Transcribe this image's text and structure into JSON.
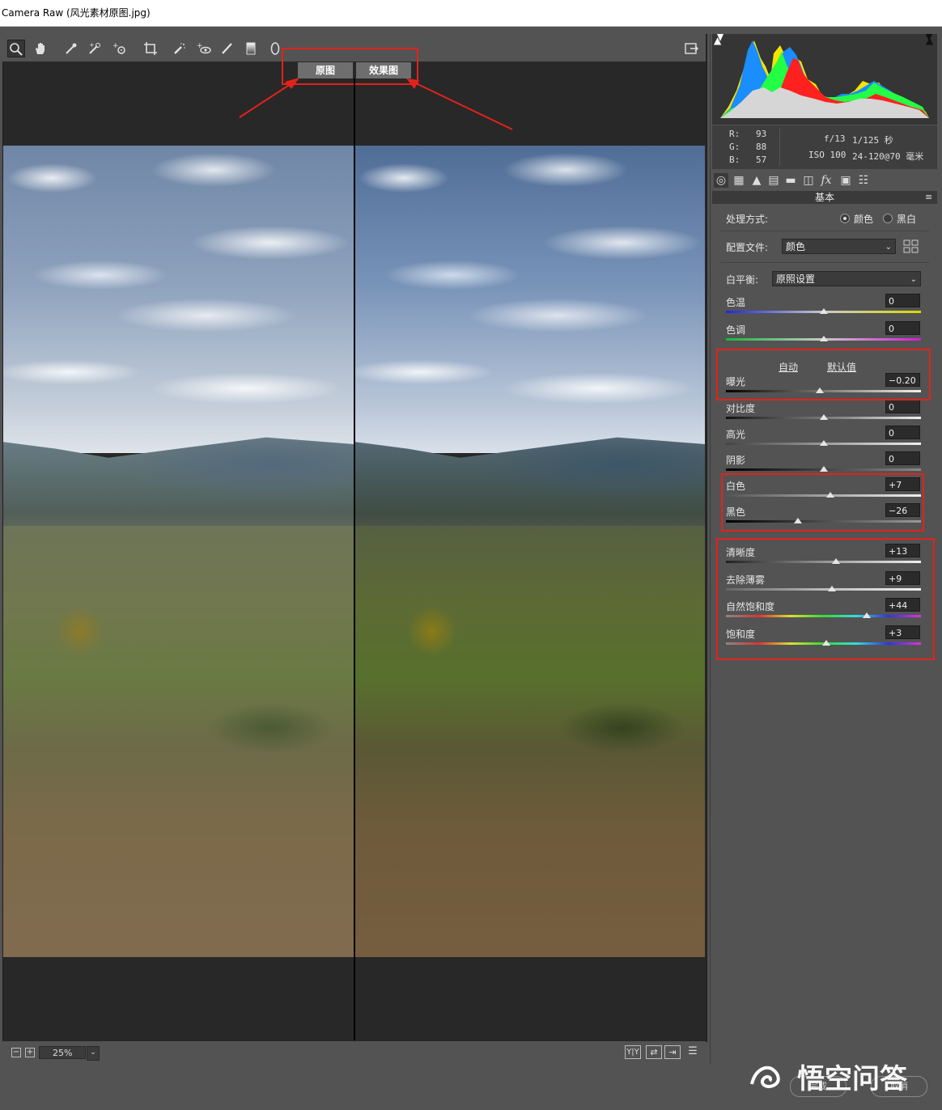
{
  "window": {
    "title": "Camera Raw (风光素材原图.jpg)"
  },
  "toolbar": {
    "tools": [
      "zoom-icon",
      "hand-icon",
      "white-balance-icon",
      "color-sampler-icon",
      "targeted-adjust-icon",
      "crop-icon",
      "spot-removal-icon",
      "red-eye-icon",
      "adjustment-brush-icon",
      "graduated-filter-icon",
      "radial-filter-icon"
    ],
    "open_preferences": "open-dialog-icon"
  },
  "compare": {
    "before_label": "原图",
    "after_label": "效果图"
  },
  "status": {
    "zoom": "25%"
  },
  "info": {
    "r_label": "R:",
    "r": "93",
    "g_label": "G:",
    "g": "88",
    "b_label": "B:",
    "b": "57",
    "aperture": "f/13",
    "shutter": "1/125 秒",
    "iso": "ISO 100",
    "lens": "24-120@70 毫米"
  },
  "panel": {
    "section": "基本",
    "treatment_label": "处理方式:",
    "treatment_color": "颜色",
    "treatment_bw": "黑白",
    "profile_label": "配置文件:",
    "profile_value": "颜色",
    "wb_label": "白平衡:",
    "wb_value": "原照设置",
    "auto": "自动",
    "default": "默认值",
    "sliders": [
      {
        "label": "色温",
        "value": "0",
        "level": 0.5
      },
      {
        "label": "色调",
        "value": "0",
        "level": 0.5
      },
      {
        "label": "曝光",
        "value": "−0.20",
        "level": 0.48
      },
      {
        "label": "对比度",
        "value": "0",
        "level": 0.5
      },
      {
        "label": "高光",
        "value": "0",
        "level": 0.5
      },
      {
        "label": "阴影",
        "value": "0",
        "level": 0.5
      },
      {
        "label": "白色",
        "value": "+7",
        "level": 0.535
      },
      {
        "label": "黑色",
        "value": "−26",
        "level": 0.37
      },
      {
        "label": "清晰度",
        "value": "+13",
        "level": 0.565
      },
      {
        "label": "去除薄雾",
        "value": "+9",
        "level": 0.545
      },
      {
        "label": "自然饱和度",
        "value": "+44",
        "level": 0.72
      },
      {
        "label": "饱和度",
        "value": "+3",
        "level": 0.515
      }
    ]
  },
  "watermark": {
    "text": "悟空问答",
    "btn1": "完成",
    "btn2": "取消"
  },
  "colors": {
    "highlight": "#e3221b",
    "panel_bg": "#535353",
    "viewer_bg": "#282828"
  }
}
